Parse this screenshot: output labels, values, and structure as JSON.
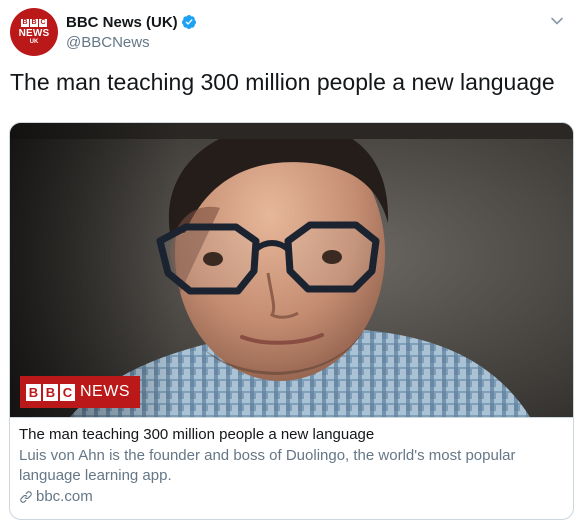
{
  "author": {
    "avatar": {
      "blocks": [
        "B",
        "B",
        "C"
      ],
      "news": "NEWS",
      "region": "UK"
    },
    "display_name": "BBC News (UK)",
    "handle": "@BBCNews"
  },
  "tweet": {
    "text": "The man teaching 300 million people a new language"
  },
  "card": {
    "badge": {
      "blocks": [
        "B",
        "B",
        "C"
      ],
      "news": "NEWS"
    },
    "title": "The man teaching 300 million people a new language",
    "description": "Luis von Ahn is the founder and boss of Duolingo, the world's most popular language learning app.",
    "domain": "bbc.com"
  },
  "colors": {
    "brand_red": "#bb1919",
    "verified_blue": "#1da1f2",
    "secondary_text": "#657786",
    "border": "#ccd6dd"
  },
  "icons": {
    "verified": "verified-badge-icon",
    "more": "chevron-down-icon",
    "link": "link-icon"
  }
}
